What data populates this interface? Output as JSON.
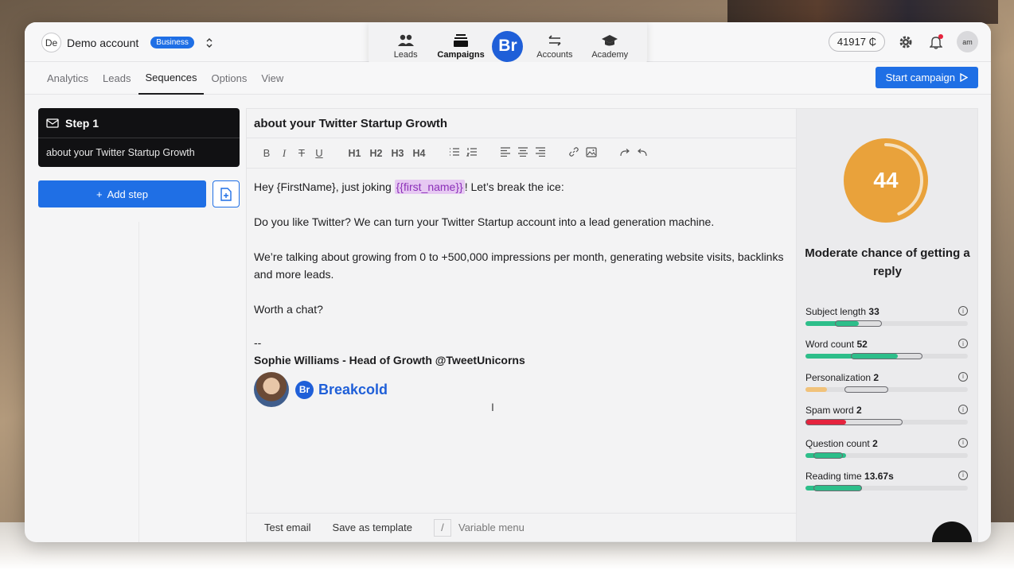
{
  "account": {
    "initials": "De",
    "name": "Demo account",
    "plan_badge": "Business"
  },
  "center_nav": {
    "items": [
      {
        "label": "Leads",
        "icon": "users-icon"
      },
      {
        "label": "Campaigns",
        "icon": "inbox-stack-icon",
        "active": true
      },
      {
        "label": "Accounts",
        "icon": "arrows-swap-icon"
      },
      {
        "label": "Academy",
        "icon": "graduation-cap-icon"
      }
    ],
    "logo_text": "Br"
  },
  "top_right": {
    "credits": "41917",
    "avatar_initials": "am"
  },
  "tabs": [
    "Analytics",
    "Leads",
    "Sequences",
    "Options",
    "View"
  ],
  "active_tab": "Sequences",
  "start_campaign_label": "Start campaign",
  "sequence": {
    "step_title": "Step 1",
    "step_subject": "about your Twitter Startup Growth",
    "add_step_label": "Add step"
  },
  "editor": {
    "subject": "about your Twitter Startup Growth",
    "toolbar": {
      "headings": [
        "H1",
        "H2",
        "H3",
        "H4"
      ]
    },
    "body": {
      "greeting_before": "Hey {FirstName}, just joking ",
      "variable": "{{first_name}}",
      "greeting_after": "! Let’s break the ice:",
      "p1": "Do you like Twitter? We can turn your Twitter Startup account into a lead generation machine.",
      "p2": "We’re talking about growing from 0 to +500,000 impressions per month, generating website visits, backlinks and more leads.",
      "p3": "Worth a chat?",
      "separator": "--",
      "signature": "Sophie Williams - Head of Growth @TweetUnicorns",
      "brand": "Breakcold",
      "brand_logo": "Br"
    },
    "bottom": {
      "test_email": "Test email",
      "save_template": "Save as template",
      "slash": "/",
      "variable_menu": "Variable menu"
    }
  },
  "score_panel": {
    "score": "44",
    "score_value": 44,
    "verdict": "Moderate chance of getting a reply",
    "ring_color": "#e9a23b",
    "metrics": [
      {
        "label": "Subject length",
        "value": "33",
        "fill": 0.33,
        "range": [
          0.18,
          0.47
        ],
        "color": "#2dbe8a"
      },
      {
        "label": "Word count",
        "value": "52",
        "fill": 0.57,
        "range": [
          0.28,
          0.72
        ],
        "color": "#2dbe8a"
      },
      {
        "label": "Personalization",
        "value": "2",
        "fill": 0.13,
        "range": [
          0.24,
          0.51
        ],
        "color": "#f1c27a"
      },
      {
        "label": "Spam word",
        "value": "2",
        "fill": 0.25,
        "range": [
          0.0,
          0.6
        ],
        "color": "#e5233d"
      },
      {
        "label": "Question count",
        "value": "2",
        "fill": 0.25,
        "range": [
          0.05,
          0.23
        ],
        "color": "#2dbe8a"
      },
      {
        "label": "Reading time",
        "value": "13.67s",
        "fill": 0.35,
        "range": [
          0.05,
          0.35
        ],
        "color": "#2dbe8a"
      }
    ]
  }
}
